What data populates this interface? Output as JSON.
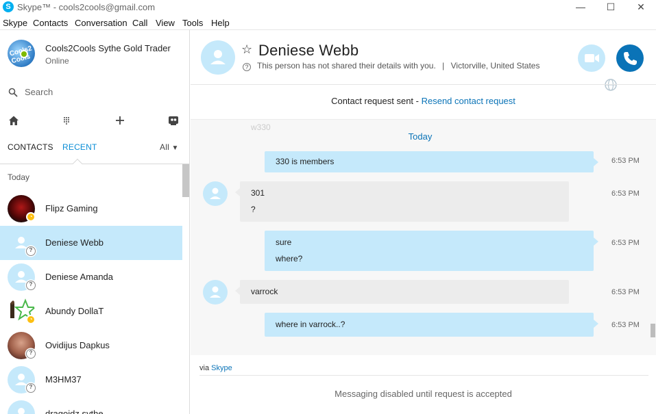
{
  "window": {
    "title": "Skype™ - cools2cools@gmail.com",
    "minimize": "—",
    "maximize": "☐",
    "close": "✕"
  },
  "menu": [
    "Skype",
    "Contacts",
    "Conversation",
    "Call",
    "View",
    "Tools",
    "Help"
  ],
  "profile": {
    "name": "Cools2Cools Sythe Gold Trader",
    "status": "Online",
    "avatar_text": "Cools2 Cools"
  },
  "search": {
    "label": "Search"
  },
  "toolbar": {
    "icons": [
      "home-icon",
      "dialpad-icon",
      "add-icon",
      "bot-icon"
    ]
  },
  "tabs": {
    "contacts": "CONTACTS",
    "recent": "RECENT",
    "filter": "All"
  },
  "sidebar": {
    "group": "Today",
    "contacts": [
      {
        "name": "Flipz Gaming",
        "status": "away",
        "active": false
      },
      {
        "name": "Deniese  Webb",
        "status": "unknown",
        "active": true
      },
      {
        "name": "Deniese Amanda",
        "status": "unknown",
        "active": false
      },
      {
        "name": "Abundy DollaT",
        "status": "away",
        "active": false
      },
      {
        "name": "Ovidijus Dapkus",
        "status": "unknown",
        "active": false
      },
      {
        "name": "M3HM37",
        "status": "unknown",
        "active": false
      },
      {
        "name": "dragoidz sythe",
        "status": "unknown",
        "active": false
      }
    ]
  },
  "header": {
    "name": "Deniese  Webb",
    "info": "This person has not shared their details with you.",
    "separator": "|",
    "location": "Victorville, United States"
  },
  "request": {
    "text": "Contact request sent - ",
    "link": "Resend contact request"
  },
  "chat": {
    "ghost_text": "w330",
    "day_label": "Today",
    "messages": [
      {
        "direction": "out",
        "lines": [
          "330 is members"
        ],
        "time": "6:53 PM"
      },
      {
        "direction": "in",
        "lines": [
          "301",
          "?"
        ],
        "time": "6:53 PM"
      },
      {
        "direction": "out",
        "lines": [
          "sure",
          "where?"
        ],
        "time": "6:53 PM"
      },
      {
        "direction": "in",
        "lines": [
          "varrock"
        ],
        "time": "6:53 PM"
      },
      {
        "direction": "out",
        "lines": [
          "where in varrock..?"
        ],
        "time": "6:53 PM"
      }
    ]
  },
  "footer": {
    "via_prefix": "via ",
    "via_link": "Skype",
    "disabled_text": "Messaging disabled until request is accepted"
  },
  "colors": {
    "accent": "#0a73b7",
    "bubble_out": "#c5e9fb",
    "bubble_in": "#ececec",
    "online": "#7fba00",
    "away": "#fdbf12"
  }
}
